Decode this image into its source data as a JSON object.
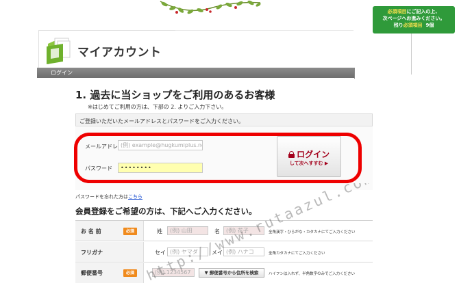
{
  "notice": {
    "line1_required": "必須項目",
    "line1_rest": "にご記入の上、",
    "line2": "次ページへお進みください。",
    "line3_prefix": "残り",
    "line3_required": "必須項目",
    "line3_count": "9個"
  },
  "header": {
    "title": "マイアカウント",
    "breadcrumb": "ログイン"
  },
  "login_section": {
    "title": "1. 過去に当ショップをご利用のあるお客様",
    "subtitle": "※はじめてご利用の方は、下部の 2. よりご入力下さい。",
    "panel_heading": "ご登録いただいたメールアドレスとパスワードをご入力ください。",
    "email_label": "メールアドレス",
    "email_placeholder": "(例) example@hugkumiplus.net",
    "password_label": "パスワード",
    "password_value": "••••••••",
    "login_button_label": "ログイン",
    "login_button_sub": "して次へすすむ ▶",
    "forgot_text": "パスワードを忘れた方は",
    "forgot_link": "こちら"
  },
  "register_section": {
    "title": "会員登録をご希望の方は、下記へご入力ください。",
    "required_badge": "必須",
    "rows": [
      {
        "label": "お 名 前",
        "field1_label": "姓",
        "field1_placeholder": "(例) 山田",
        "field2_label": "名",
        "field2_placeholder": "(例) 花子",
        "note": "全角漢字・ひらがな・カタカナにてご入力ください"
      },
      {
        "label": "フリガナ",
        "field1_label": "セイ",
        "field1_placeholder": "(例) ヤマダ",
        "field2_label": "メイ",
        "field2_placeholder": "(例) ハナコ",
        "note": "全角カタカナにてご入力ください"
      },
      {
        "label": "郵便番号",
        "field1_placeholder": "(例) 1234567",
        "button_label": "▼ 郵便番号から住所を検索",
        "note": "ハイフンは入れず、半角数字のみでご入力ください"
      }
    ]
  },
  "watermark": "http://www.rutaazul.com/"
}
